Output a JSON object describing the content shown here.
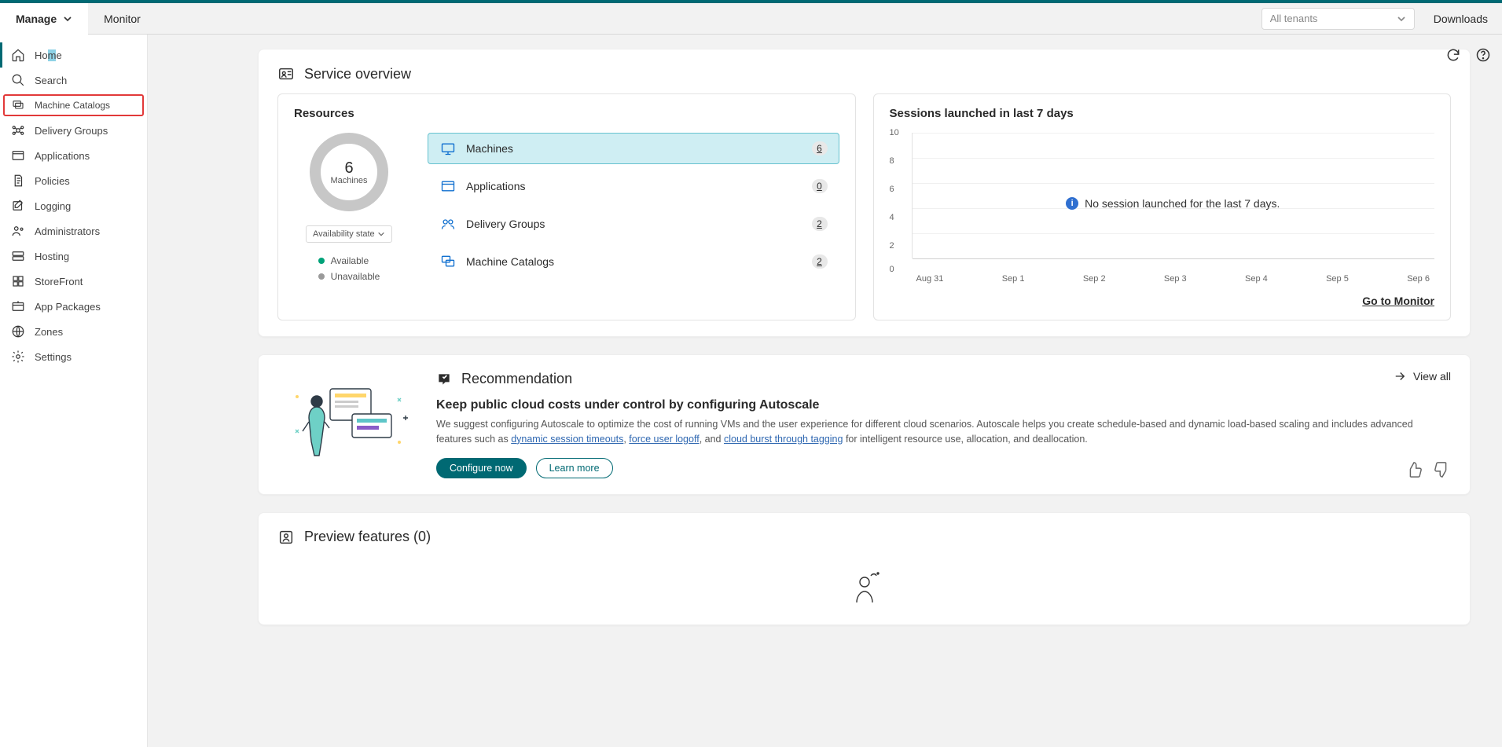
{
  "header": {
    "manage_label": "Manage",
    "monitor_label": "Monitor",
    "tenant_placeholder": "All tenants",
    "downloads_label": "Downloads"
  },
  "sidebar": {
    "items": [
      {
        "label": "Home",
        "icon": "home-icon"
      },
      {
        "label": "Search",
        "icon": "search-icon"
      },
      {
        "label": "Machine Catalogs",
        "icon": "catalog-icon"
      },
      {
        "label": "Delivery Groups",
        "icon": "delivery-icon"
      },
      {
        "label": "Applications",
        "icon": "apps-icon"
      },
      {
        "label": "Policies",
        "icon": "policies-icon"
      },
      {
        "label": "Logging",
        "icon": "logging-icon"
      },
      {
        "label": "Administrators",
        "icon": "admins-icon"
      },
      {
        "label": "Hosting",
        "icon": "hosting-icon"
      },
      {
        "label": "StoreFront",
        "icon": "storefront-icon"
      },
      {
        "label": "App Packages",
        "icon": "packages-icon"
      },
      {
        "label": "Zones",
        "icon": "zones-icon"
      },
      {
        "label": "Settings",
        "icon": "settings-icon"
      }
    ]
  },
  "overview": {
    "title": "Service overview",
    "resources": {
      "title": "Resources",
      "donut_value": "6",
      "donut_label": "Machines",
      "availability_label": "Availability state",
      "legend_available": "Available",
      "legend_unavailable": "Unavailable",
      "items": [
        {
          "label": "Machines",
          "count": "6"
        },
        {
          "label": "Applications",
          "count": "0"
        },
        {
          "label": "Delivery Groups",
          "count": "2"
        },
        {
          "label": "Machine Catalogs",
          "count": "2"
        }
      ]
    },
    "sessions": {
      "title": "Sessions launched in last 7 days",
      "yTicks": [
        "10",
        "8",
        "6",
        "4",
        "2",
        "0"
      ],
      "xTicks": [
        "Aug 31",
        "Sep 1",
        "Sep 2",
        "Sep 3",
        "Sep 4",
        "Sep 5",
        "Sep 6"
      ],
      "empty_msg": "No session launched for the last 7 days.",
      "go_to_monitor": "Go to Monitor"
    }
  },
  "recommendation": {
    "header": "Recommendation",
    "view_all": "View all",
    "title": "Keep public cloud costs under control by configuring Autoscale",
    "text_pre": "We suggest configuring Autoscale to optimize the cost of running VMs and the user experience for different cloud scenarios. Autoscale helps you create schedule-based and dynamic load-based scaling and includes advanced features such as ",
    "link1": "dynamic session timeouts",
    "sep1": ", ",
    "link2": "force user logoff",
    "sep2": ", and ",
    "link3": "cloud burst through tagging",
    "text_post": " for intelligent resource use, allocation, and deallocation.",
    "btn_primary": "Configure now",
    "btn_secondary": "Learn more"
  },
  "preview": {
    "title": "Preview features (0)"
  },
  "chart_data": {
    "type": "line",
    "title": "Sessions launched in last 7 days",
    "xlabel": "",
    "ylabel": "",
    "ylim": [
      0,
      10
    ],
    "categories": [
      "Aug 31",
      "Sep 1",
      "Sep 2",
      "Sep 3",
      "Sep 4",
      "Sep 5",
      "Sep 6"
    ],
    "values": [
      0,
      0,
      0,
      0,
      0,
      0,
      0
    ],
    "annotation": "No session launched for the last 7 days."
  }
}
